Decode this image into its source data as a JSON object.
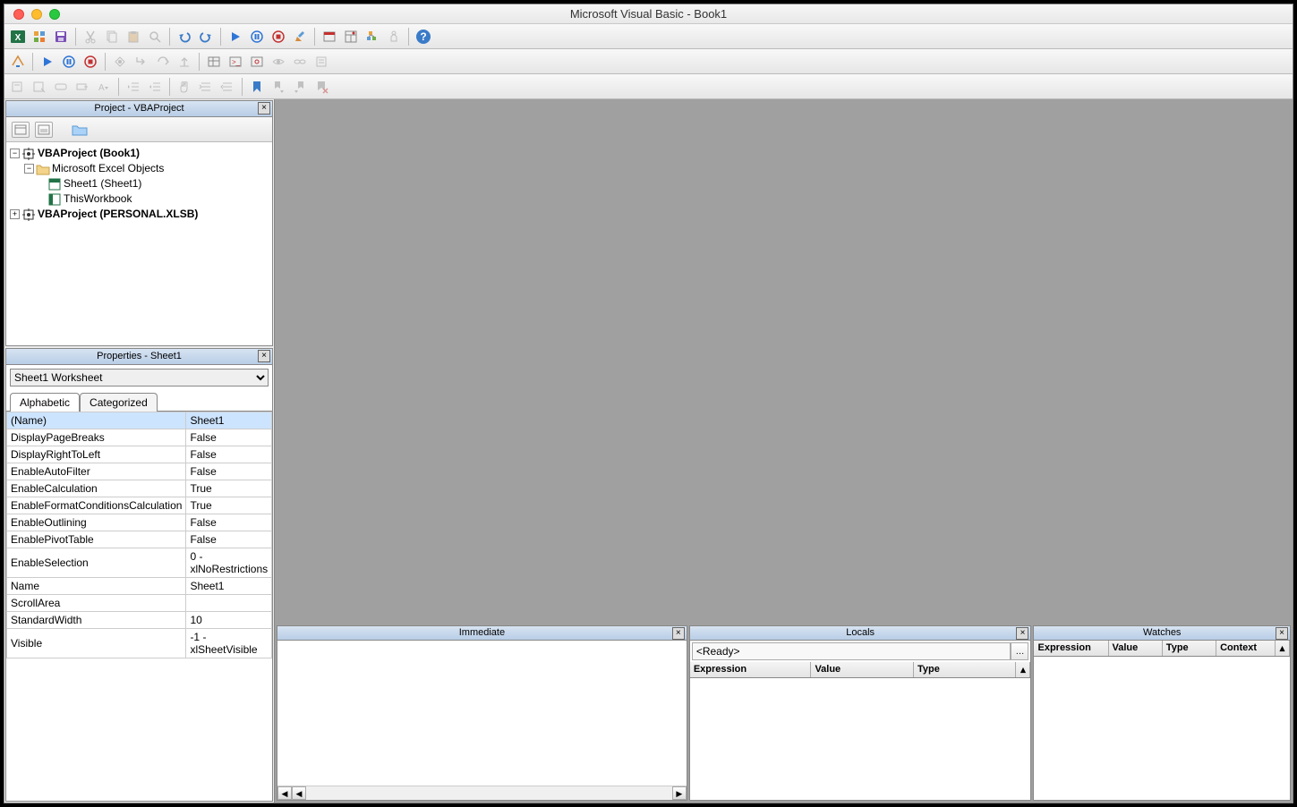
{
  "window": {
    "title": "Microsoft Visual Basic - Book1"
  },
  "panels": {
    "project": {
      "title": "Project - VBAProject"
    },
    "properties": {
      "title": "Properties - Sheet1"
    },
    "immediate": {
      "title": "Immediate"
    },
    "locals": {
      "title": "Locals",
      "ready": "<Ready>"
    },
    "watches": {
      "title": "Watches"
    }
  },
  "tree": {
    "root1": "VBAProject (Book1)",
    "folder1": "Microsoft Excel Objects",
    "item1": "Sheet1 (Sheet1)",
    "item2": "ThisWorkbook",
    "root2": "VBAProject (PERSONAL.XLSB)"
  },
  "properties": {
    "object": "Sheet1 Worksheet",
    "tabs": {
      "alphabetic": "Alphabetic",
      "categorized": "Categorized"
    },
    "rows": [
      {
        "name": "(Name)",
        "value": "Sheet1"
      },
      {
        "name": "DisplayPageBreaks",
        "value": "False"
      },
      {
        "name": "DisplayRightToLeft",
        "value": "False"
      },
      {
        "name": "EnableAutoFilter",
        "value": "False"
      },
      {
        "name": "EnableCalculation",
        "value": "True"
      },
      {
        "name": "EnableFormatConditionsCalculation",
        "value": "True"
      },
      {
        "name": "EnableOutlining",
        "value": "False"
      },
      {
        "name": "EnablePivotTable",
        "value": "False"
      },
      {
        "name": "EnableSelection",
        "value": "0 - xlNoRestrictions"
      },
      {
        "name": "Name",
        "value": "Sheet1"
      },
      {
        "name": "ScrollArea",
        "value": ""
      },
      {
        "name": "StandardWidth",
        "value": "10"
      },
      {
        "name": "Visible",
        "value": "-1 - xlSheetVisible"
      }
    ]
  },
  "locals_headers": {
    "expr": "Expression",
    "val": "Value",
    "type": "Type"
  },
  "watches_headers": {
    "expr": "Expression",
    "val": "Value",
    "type": "Type",
    "ctx": "Context"
  }
}
